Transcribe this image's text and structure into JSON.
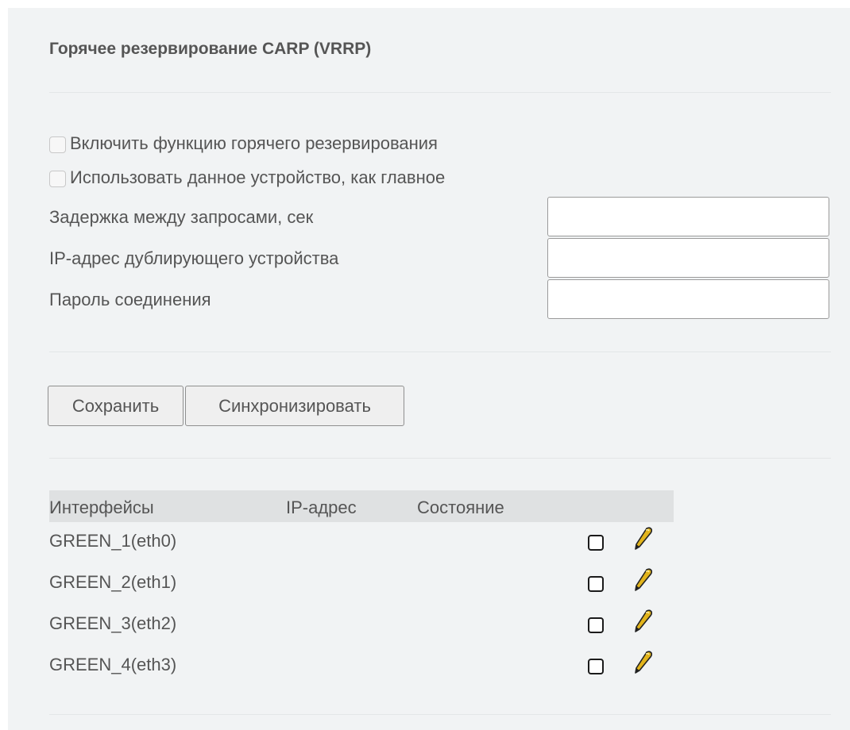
{
  "panel": {
    "title": "Горячее резервирование CARP (VRRP)"
  },
  "options": {
    "enable_label": "Включить функцию горячего резервирования",
    "enable_checked": false,
    "master_label": "Использовать данное устройство, как главное",
    "master_checked": false
  },
  "fields": {
    "delay_label": "Задержка между запросами, сек",
    "delay_value": "",
    "peer_ip_label": "IP-адрес дублирующего устройства",
    "peer_ip_value": "",
    "password_label": "Пароль соединения",
    "password_value": ""
  },
  "buttons": {
    "save_label": "Сохранить",
    "sync_label": "Синхронизировать"
  },
  "interfaces": {
    "columns": [
      "Интерфейсы",
      "IP-адрес",
      "Состояние"
    ],
    "rows": [
      {
        "name": "GREEN_1(eth0)",
        "ip": "",
        "state": "",
        "checked": false,
        "edit_icon": "pencil-icon"
      },
      {
        "name": "GREEN_2(eth1)",
        "ip": "",
        "state": "",
        "checked": false,
        "edit_icon": "pencil-icon"
      },
      {
        "name": "GREEN_3(eth2)",
        "ip": "",
        "state": "",
        "checked": false,
        "edit_icon": "pencil-icon"
      },
      {
        "name": "GREEN_4(eth3)",
        "ip": "",
        "state": "",
        "checked": false,
        "edit_icon": "pencil-icon"
      }
    ]
  },
  "colors": {
    "panel_bg": "#f1f3f4",
    "text": "#555555",
    "header_bg": "#dfe1e2",
    "pencil": "#e2b41b"
  }
}
